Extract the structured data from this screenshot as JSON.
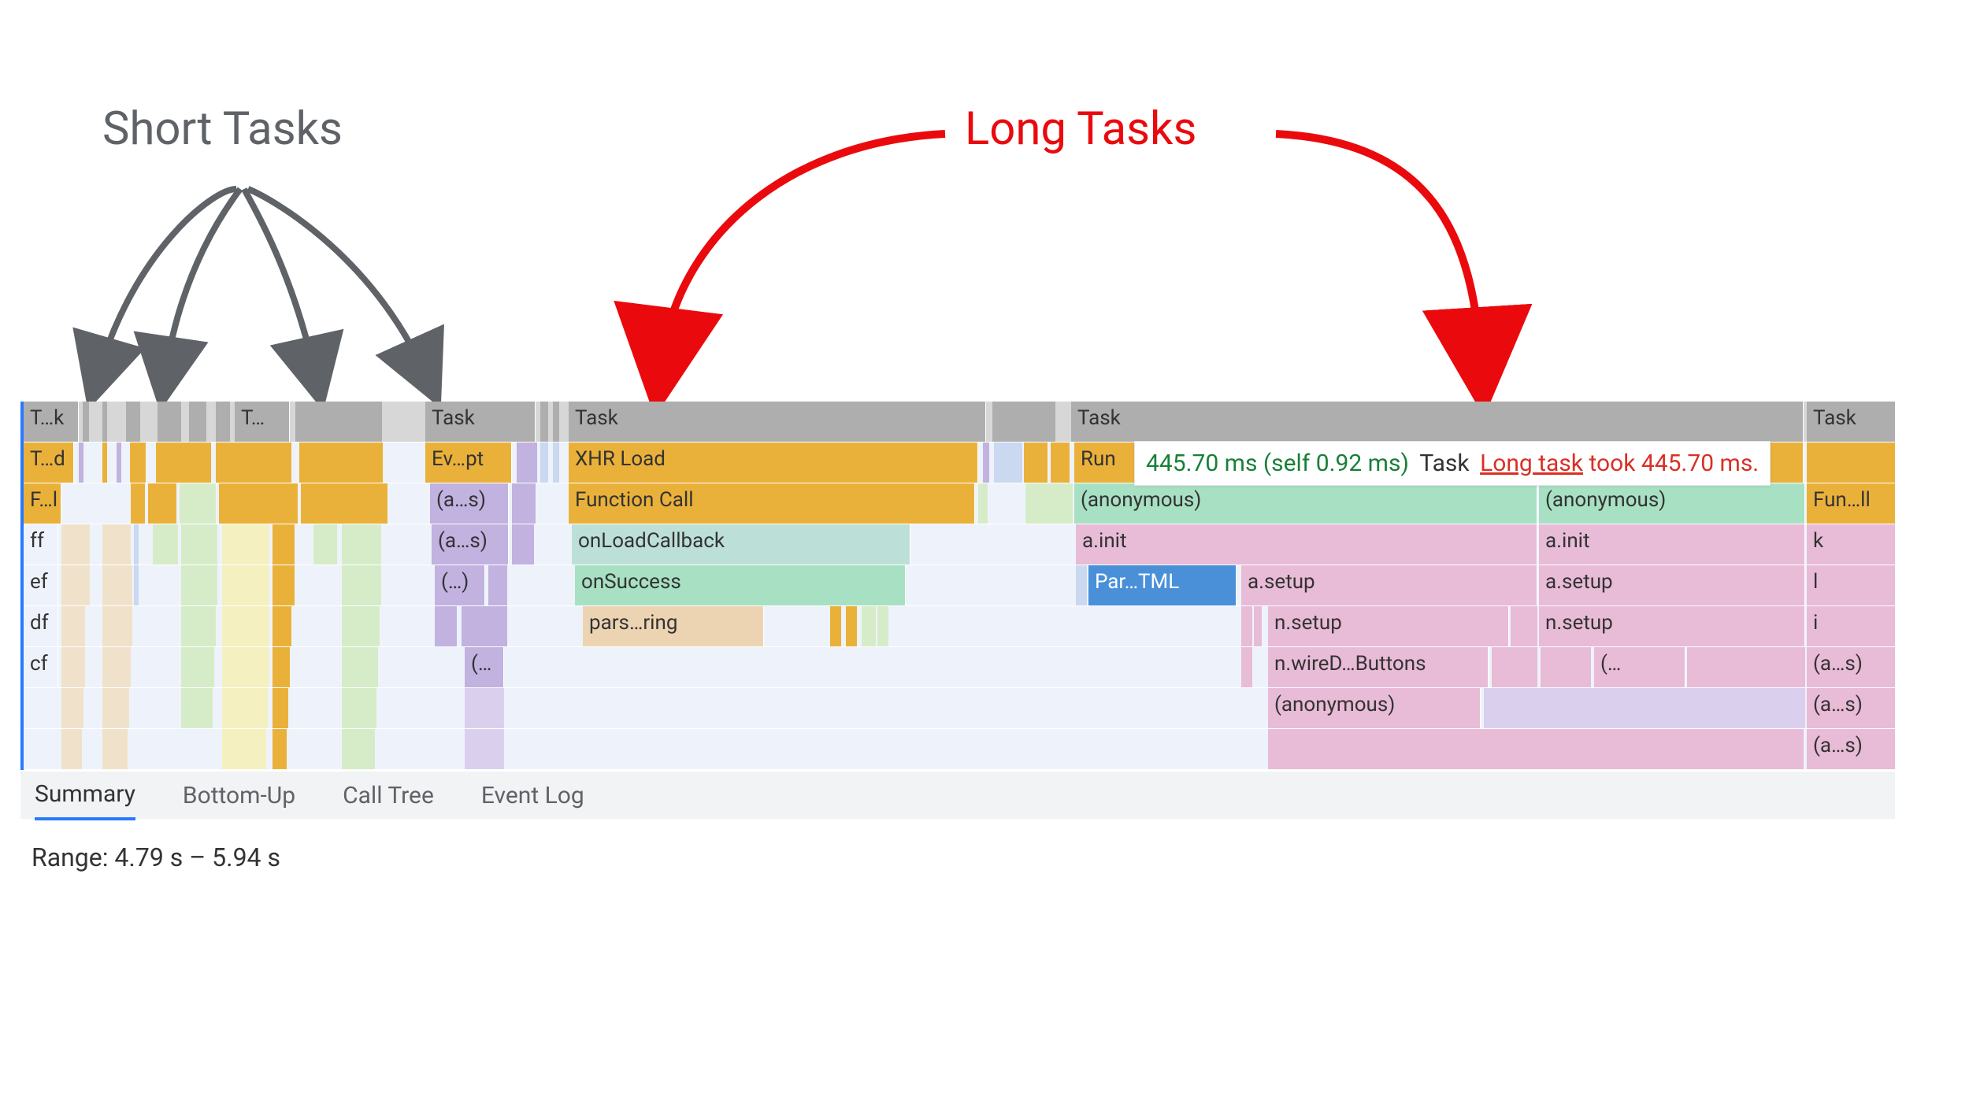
{
  "annotations": {
    "short_tasks": "Short Tasks",
    "long_tasks": "Long Tasks"
  },
  "tooltip": {
    "timing": "445.70 ms (self 0.92 ms)",
    "label": "Task",
    "link_text": "Long task",
    "warn_suffix": "took 445.70 ms."
  },
  "flame": {
    "row0": {
      "c0": "T…k",
      "c1": "T…",
      "c2": "Task",
      "c3": "Task",
      "c4": "Task",
      "c5": "Task"
    },
    "row1": {
      "c0": "T…d",
      "c1": "Ev…pt",
      "c2": "XHR Load",
      "c3": "Run"
    },
    "row2": {
      "c0": "F…l",
      "c1": "(a…s)",
      "c2": "Function Call",
      "c3": "(anonymous)",
      "c4": "(anonymous)",
      "c5": "Fun…ll"
    },
    "row3": {
      "c0": "ff",
      "c1": "(a…s)",
      "c2": "onLoadCallback",
      "c3": "a.init",
      "c4": "a.init",
      "c5": "k"
    },
    "row4": {
      "c0": "ef",
      "c1": "(…)",
      "c2": "onSuccess",
      "c3": "Par…TML",
      "c4": "a.setup",
      "c5": "a.setup",
      "c6": "l"
    },
    "row5": {
      "c0": "df",
      "c1": "pars…ring",
      "c2": "n.setup",
      "c3": "n.setup",
      "c4": "i"
    },
    "row6": {
      "c0": "cf",
      "c1": "(…",
      "c2": "n.wireD…Buttons",
      "c3": "(…",
      "c4": "(a…s)"
    },
    "row7": {
      "c0": "(anonymous)",
      "c1": "(a…s)"
    },
    "row8": {
      "c0": "(a…s)"
    }
  },
  "tabs": {
    "summary": "Summary",
    "bottom_up": "Bottom-Up",
    "call_tree": "Call Tree",
    "event_log": "Event Log"
  },
  "range_label": "Range: 4.79 s – 5.94 s"
}
